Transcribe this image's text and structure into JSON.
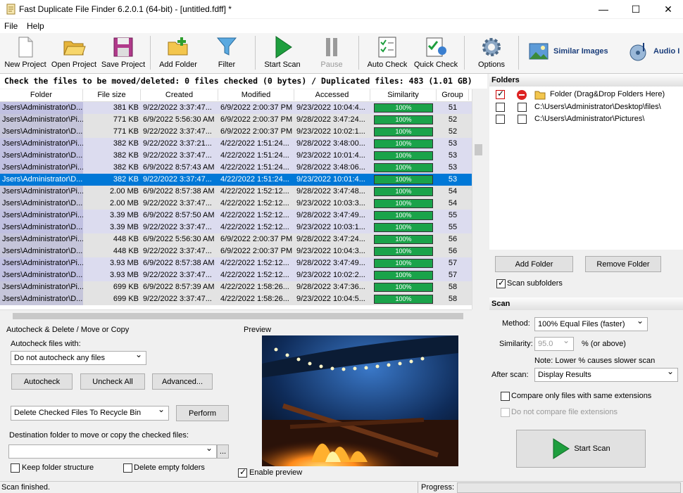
{
  "window": {
    "title": "Fast Duplicate File Finder 6.2.0.1 (64-bit) - [untitled.fdff] *",
    "minimize": "—",
    "maximize": "☐",
    "close": "✕"
  },
  "menu": [
    "File",
    "Help"
  ],
  "toolbar": {
    "new_project": "New Project",
    "open_project": "Open Project",
    "save_project": "Save Project",
    "add_folder": "Add Folder",
    "filter": "Filter",
    "start_scan": "Start Scan",
    "pause": "Pause",
    "auto_check": "Auto Check",
    "quick_check": "Quick Check",
    "options": "Options",
    "similar_images": "Similar Images",
    "audio": "Audio I"
  },
  "status_line": "Check the files to be moved/deleted: 0 files checked (0 bytes) / Duplicated files: 483 (1.01 GB)",
  "grid": {
    "columns": [
      "Folder",
      "File size",
      "Created",
      "Modified",
      "Accessed",
      "Similarity",
      "Group"
    ],
    "rows": [
      [
        "Jsers\\Administrator\\D...",
        "381 KB",
        "9/22/2022 3:37:47...",
        "6/9/2022 2:00:37 PM",
        "9/23/2022 10:04:4...",
        "100%",
        "51"
      ],
      [
        "Jsers\\Administrator\\Pi...",
        "771 KB",
        "6/9/2022 5:56:30 AM",
        "6/9/2022 2:00:37 PM",
        "9/28/2022 3:47:24...",
        "100%",
        "52"
      ],
      [
        "Jsers\\Administrator\\D...",
        "771 KB",
        "9/22/2022 3:37:47...",
        "6/9/2022 2:00:37 PM",
        "9/23/2022 10:02:1...",
        "100%",
        "52"
      ],
      [
        "Jsers\\Administrator\\Pi...",
        "382 KB",
        "9/22/2022 3:37:21...",
        "4/22/2022 1:51:24...",
        "9/28/2022 3:48:00...",
        "100%",
        "53"
      ],
      [
        "Jsers\\Administrator\\D...",
        "382 KB",
        "9/22/2022 3:37:47...",
        "4/22/2022 1:51:24...",
        "9/23/2022 10:01:4...",
        "100%",
        "53"
      ],
      [
        "Jsers\\Administrator\\Pi...",
        "382 KB",
        "6/9/2022 8:57:43 AM",
        "4/22/2022 1:51:24...",
        "9/28/2022 3:48:06...",
        "100%",
        "53"
      ],
      [
        "Jsers\\Administrator\\D...",
        "382 KB",
        "9/22/2022 3:37:47...",
        "4/22/2022 1:51:24...",
        "9/23/2022 10:01:4...",
        "100%",
        "53"
      ],
      [
        "Jsers\\Administrator\\Pi...",
        "2.00 MB",
        "6/9/2022 8:57:38 AM",
        "4/22/2022 1:52:12...",
        "9/28/2022 3:47:48...",
        "100%",
        "54"
      ],
      [
        "Jsers\\Administrator\\D...",
        "2.00 MB",
        "9/22/2022 3:37:47...",
        "4/22/2022 1:52:12...",
        "9/23/2022 10:03:3...",
        "100%",
        "54"
      ],
      [
        "Jsers\\Administrator\\Pi...",
        "3.39 MB",
        "6/9/2022 8:57:50 AM",
        "4/22/2022 1:52:12...",
        "9/28/2022 3:47:49...",
        "100%",
        "55"
      ],
      [
        "Jsers\\Administrator\\D...",
        "3.39 MB",
        "9/22/2022 3:37:47...",
        "4/22/2022 1:52:12...",
        "9/23/2022 10:03:1...",
        "100%",
        "55"
      ],
      [
        "Jsers\\Administrator\\Pi...",
        "448 KB",
        "6/9/2022 5:56:30 AM",
        "6/9/2022 2:00:37 PM",
        "9/28/2022 3:47:24...",
        "100%",
        "56"
      ],
      [
        "Jsers\\Administrator\\D...",
        "448 KB",
        "9/22/2022 3:37:47...",
        "6/9/2022 2:00:37 PM",
        "9/23/2022 10:04:3...",
        "100%",
        "56"
      ],
      [
        "Jsers\\Administrator\\Pi...",
        "3.93 MB",
        "6/9/2022 8:57:38 AM",
        "4/22/2022 1:52:12...",
        "9/28/2022 3:47:49...",
        "100%",
        "57"
      ],
      [
        "Jsers\\Administrator\\D...",
        "3.93 MB",
        "9/22/2022 3:37:47...",
        "4/22/2022 1:52:12...",
        "9/23/2022 10:02:2...",
        "100%",
        "57"
      ],
      [
        "Jsers\\Administrator\\Pi...",
        "699 KB",
        "6/9/2022 8:57:39 AM",
        "4/22/2022 1:58:26...",
        "9/28/2022 3:47:36...",
        "100%",
        "58"
      ],
      [
        "Jsers\\Administrator\\D...",
        "699 KB",
        "9/22/2022 3:37:47...",
        "4/22/2022 1:58:26...",
        "9/23/2022 10:04:5...",
        "100%",
        "58"
      ]
    ],
    "selected_row": 6
  },
  "autocheck": {
    "section_title": "Autocheck & Delete / Move or Copy",
    "autocheck_with_label": "Autocheck files with:",
    "autocheck_value": "Do not autocheck any files",
    "autocheck_btn": "Autocheck",
    "uncheck_all_btn": "Uncheck All",
    "advanced_btn": "Advanced...",
    "action_value": "Delete Checked Files To Recycle Bin",
    "perform_btn": "Perform",
    "dest_label": "Destination folder to move or copy the checked files:",
    "dest_value": "",
    "browse_btn": "...",
    "keep_structure": "Keep folder structure",
    "delete_empty": "Delete empty folders"
  },
  "preview": {
    "title": "Preview",
    "enable_label": "Enable preview"
  },
  "folders": {
    "title": "Folders",
    "items": [
      "Folder (Drag&Drop Folders Here)",
      "C:\\Users\\Administrator\\Desktop\\files\\",
      "C:\\Users\\Administrator\\Pictures\\"
    ],
    "add_btn": "Add Folder",
    "remove_btn": "Remove Folder",
    "scan_subfolders": "Scan subfolders"
  },
  "scan": {
    "title": "Scan",
    "method_label": "Method:",
    "method_value": "100% Equal Files (faster)",
    "similarity_label": "Similarity:",
    "similarity_value": "95.0",
    "similarity_unit": "% (or above)",
    "note": "Note: Lower % causes slower scan",
    "after_label": "After scan:",
    "after_value": "Display Results",
    "compare_same_ext": "Compare only files with same extensions",
    "no_compare_ext": "Do not compare file extensions",
    "start_btn": "Start Scan"
  },
  "statusbar": {
    "text": "Scan finished.",
    "progress_label": "Progress:"
  },
  "colors": {
    "selected": "#0078d7",
    "sim_bar": "#1aa34a",
    "green_play": "#1e9e3e"
  }
}
